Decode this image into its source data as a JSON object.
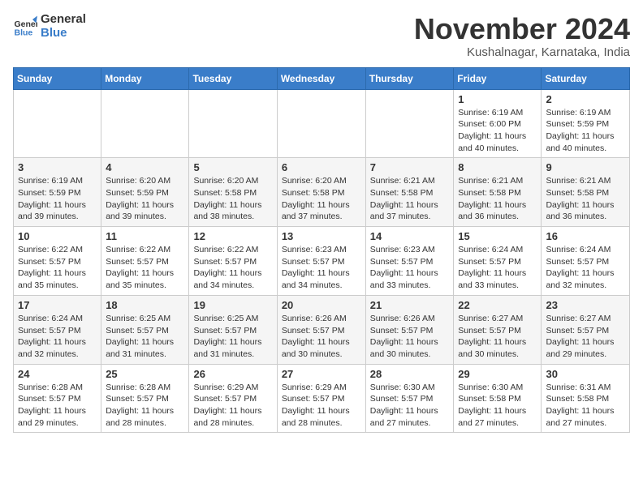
{
  "header": {
    "logo_line1": "General",
    "logo_line2": "Blue",
    "month": "November 2024",
    "location": "Kushalnagar, Karnataka, India"
  },
  "weekdays": [
    "Sunday",
    "Monday",
    "Tuesday",
    "Wednesday",
    "Thursday",
    "Friday",
    "Saturday"
  ],
  "weeks": [
    [
      {
        "day": "",
        "info": ""
      },
      {
        "day": "",
        "info": ""
      },
      {
        "day": "",
        "info": ""
      },
      {
        "day": "",
        "info": ""
      },
      {
        "day": "",
        "info": ""
      },
      {
        "day": "1",
        "info": "Sunrise: 6:19 AM\nSunset: 6:00 PM\nDaylight: 11 hours\nand 40 minutes."
      },
      {
        "day": "2",
        "info": "Sunrise: 6:19 AM\nSunset: 5:59 PM\nDaylight: 11 hours\nand 40 minutes."
      }
    ],
    [
      {
        "day": "3",
        "info": "Sunrise: 6:19 AM\nSunset: 5:59 PM\nDaylight: 11 hours\nand 39 minutes."
      },
      {
        "day": "4",
        "info": "Sunrise: 6:20 AM\nSunset: 5:59 PM\nDaylight: 11 hours\nand 39 minutes."
      },
      {
        "day": "5",
        "info": "Sunrise: 6:20 AM\nSunset: 5:58 PM\nDaylight: 11 hours\nand 38 minutes."
      },
      {
        "day": "6",
        "info": "Sunrise: 6:20 AM\nSunset: 5:58 PM\nDaylight: 11 hours\nand 37 minutes."
      },
      {
        "day": "7",
        "info": "Sunrise: 6:21 AM\nSunset: 5:58 PM\nDaylight: 11 hours\nand 37 minutes."
      },
      {
        "day": "8",
        "info": "Sunrise: 6:21 AM\nSunset: 5:58 PM\nDaylight: 11 hours\nand 36 minutes."
      },
      {
        "day": "9",
        "info": "Sunrise: 6:21 AM\nSunset: 5:58 PM\nDaylight: 11 hours\nand 36 minutes."
      }
    ],
    [
      {
        "day": "10",
        "info": "Sunrise: 6:22 AM\nSunset: 5:57 PM\nDaylight: 11 hours\nand 35 minutes."
      },
      {
        "day": "11",
        "info": "Sunrise: 6:22 AM\nSunset: 5:57 PM\nDaylight: 11 hours\nand 35 minutes."
      },
      {
        "day": "12",
        "info": "Sunrise: 6:22 AM\nSunset: 5:57 PM\nDaylight: 11 hours\nand 34 minutes."
      },
      {
        "day": "13",
        "info": "Sunrise: 6:23 AM\nSunset: 5:57 PM\nDaylight: 11 hours\nand 34 minutes."
      },
      {
        "day": "14",
        "info": "Sunrise: 6:23 AM\nSunset: 5:57 PM\nDaylight: 11 hours\nand 33 minutes."
      },
      {
        "day": "15",
        "info": "Sunrise: 6:24 AM\nSunset: 5:57 PM\nDaylight: 11 hours\nand 33 minutes."
      },
      {
        "day": "16",
        "info": "Sunrise: 6:24 AM\nSunset: 5:57 PM\nDaylight: 11 hours\nand 32 minutes."
      }
    ],
    [
      {
        "day": "17",
        "info": "Sunrise: 6:24 AM\nSunset: 5:57 PM\nDaylight: 11 hours\nand 32 minutes."
      },
      {
        "day": "18",
        "info": "Sunrise: 6:25 AM\nSunset: 5:57 PM\nDaylight: 11 hours\nand 31 minutes."
      },
      {
        "day": "19",
        "info": "Sunrise: 6:25 AM\nSunset: 5:57 PM\nDaylight: 11 hours\nand 31 minutes."
      },
      {
        "day": "20",
        "info": "Sunrise: 6:26 AM\nSunset: 5:57 PM\nDaylight: 11 hours\nand 30 minutes."
      },
      {
        "day": "21",
        "info": "Sunrise: 6:26 AM\nSunset: 5:57 PM\nDaylight: 11 hours\nand 30 minutes."
      },
      {
        "day": "22",
        "info": "Sunrise: 6:27 AM\nSunset: 5:57 PM\nDaylight: 11 hours\nand 30 minutes."
      },
      {
        "day": "23",
        "info": "Sunrise: 6:27 AM\nSunset: 5:57 PM\nDaylight: 11 hours\nand 29 minutes."
      }
    ],
    [
      {
        "day": "24",
        "info": "Sunrise: 6:28 AM\nSunset: 5:57 PM\nDaylight: 11 hours\nand 29 minutes."
      },
      {
        "day": "25",
        "info": "Sunrise: 6:28 AM\nSunset: 5:57 PM\nDaylight: 11 hours\nand 28 minutes."
      },
      {
        "day": "26",
        "info": "Sunrise: 6:29 AM\nSunset: 5:57 PM\nDaylight: 11 hours\nand 28 minutes."
      },
      {
        "day": "27",
        "info": "Sunrise: 6:29 AM\nSunset: 5:57 PM\nDaylight: 11 hours\nand 28 minutes."
      },
      {
        "day": "28",
        "info": "Sunrise: 6:30 AM\nSunset: 5:57 PM\nDaylight: 11 hours\nand 27 minutes."
      },
      {
        "day": "29",
        "info": "Sunrise: 6:30 AM\nSunset: 5:58 PM\nDaylight: 11 hours\nand 27 minutes."
      },
      {
        "day": "30",
        "info": "Sunrise: 6:31 AM\nSunset: 5:58 PM\nDaylight: 11 hours\nand 27 minutes."
      }
    ]
  ]
}
